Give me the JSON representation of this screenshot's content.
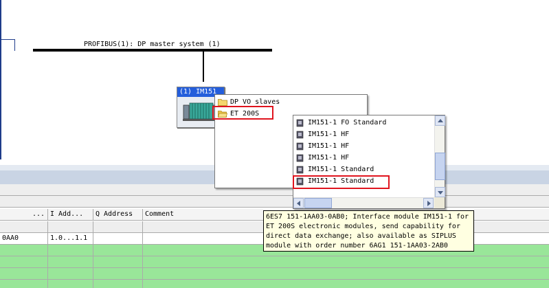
{
  "network": {
    "bus_label": "PROFIBUS(1): DP master system (1)",
    "slave_title": "(1) IM151"
  },
  "table": {
    "headers": [
      "...",
      "I Add...",
      "Q Address",
      "Comment"
    ],
    "row1": {
      "col0": "0AA0",
      "col1": "1.0...1.1"
    }
  },
  "menu1": {
    "items": [
      {
        "label": "DP VO slaves",
        "icon": "folder-icon"
      },
      {
        "label": "ET 200S",
        "icon": "folder-open-icon"
      }
    ]
  },
  "menu2": {
    "items": [
      {
        "label": "IM151-1 FO Standard",
        "icon": "module-icon"
      },
      {
        "label": "IM151-1 HF",
        "icon": "module-icon"
      },
      {
        "label": "IM151-1 HF",
        "icon": "module-icon"
      },
      {
        "label": "IM151-1 HF",
        "icon": "module-icon"
      },
      {
        "label": "IM151-1 Standard",
        "icon": "module-icon"
      },
      {
        "label": "IM151-1 Standard",
        "icon": "module-icon"
      }
    ]
  },
  "tooltip": {
    "lines": [
      "6ES7 151-1AA03-0AB0; Interface module IM151-1 for",
      "ET 200S electronic modules, send capability for",
      "direct data exchange; also available as SIPLUS",
      "module with order number 6AG1 151-1AA03-2AB0"
    ]
  },
  "colors": {
    "highlight_box": "#e0141e",
    "table_green": "#99e699",
    "title_blue": "#245edb"
  }
}
